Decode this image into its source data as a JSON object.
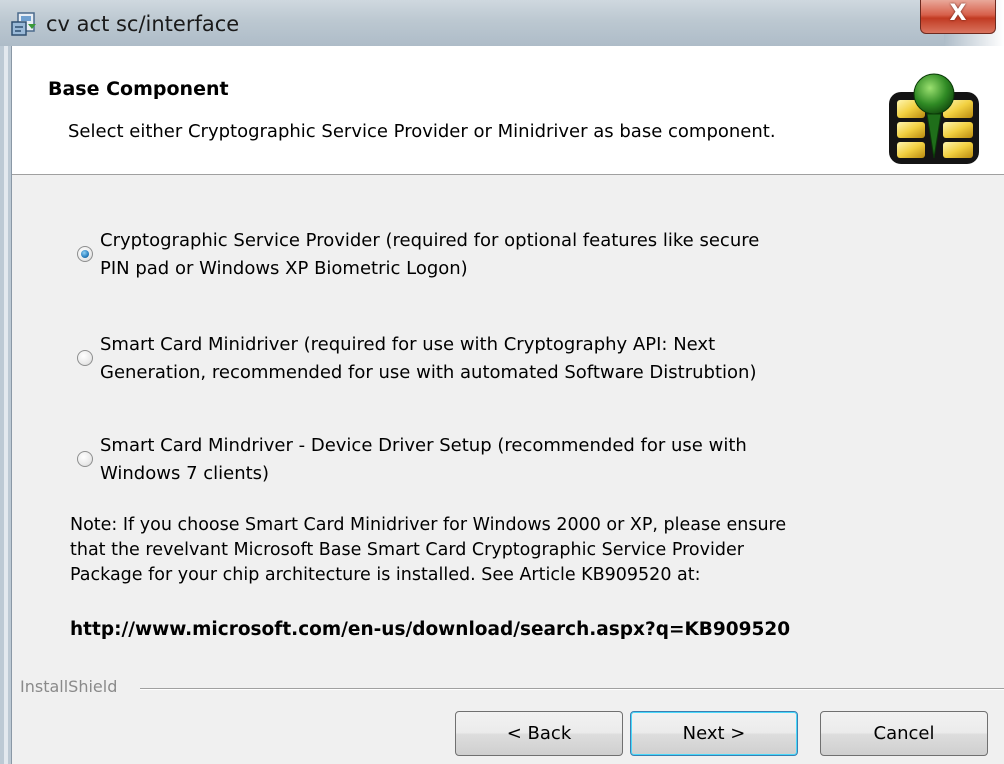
{
  "window": {
    "title": "cv act sc/interface",
    "close_label": "X"
  },
  "banner": {
    "title": "Base Component",
    "subtitle": "Select either Cryptographic Service Provider or Minidriver as base component."
  },
  "options": [
    {
      "line1": "Cryptographic Service Provider (required for optional features like secure",
      "line2": "PIN pad or Windows XP Biometric Logon)",
      "selected": true
    },
    {
      "line1": "Smart Card Minidriver (required for use with Cryptography API: Next",
      "line2": "Generation, recommended for use with automated Software Distrubtion)",
      "selected": false
    },
    {
      "line1": "Smart Card Mindriver - Device Driver Setup (recommended for use with",
      "line2": "Windows 7 clients)",
      "selected": false
    }
  ],
  "note": {
    "line1": "Note: If you choose Smart Card Minidriver for Windows 2000 or XP, please ensure",
    "line2": "that the revelvant Microsoft Base Smart Card Cryptographic Service Provider",
    "line3": "Package for your chip architecture is installed. See Article KB909520 at:",
    "url": "http://www.microsoft.com/en-us/download/search.aspx?q=KB909520"
  },
  "footer": {
    "brand": "InstallShield",
    "back_label": "< Back",
    "next_label": "Next >",
    "cancel_label": "Cancel"
  },
  "colors": {
    "accent_radio": "#2a7fbe",
    "close_button": "#c13a22",
    "default_button_border": "#3c7fb1"
  },
  "icons": {
    "app": "installer-icon",
    "banner": "smartcard-chip-logo",
    "close": "close-icon"
  }
}
